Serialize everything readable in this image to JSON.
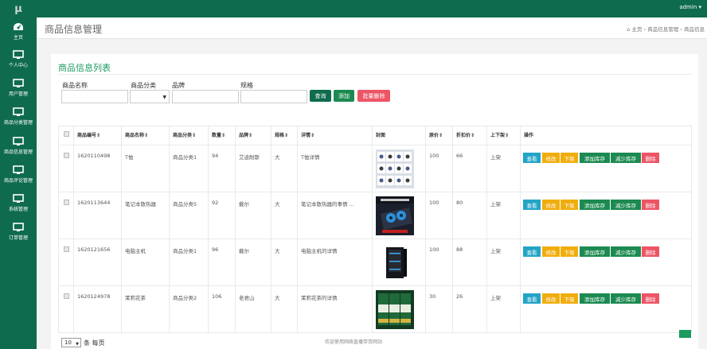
{
  "app": {
    "logo": "µ",
    "user": "admin ▾"
  },
  "sidebar": {
    "items": [
      {
        "label": "主页",
        "icon": "dashboard-icon"
      },
      {
        "label": "个人中心",
        "icon": "monitor-icon"
      },
      {
        "label": "用户管理",
        "icon": "monitor-icon"
      },
      {
        "label": "商品分类管理",
        "icon": "monitor-icon"
      },
      {
        "label": "商品信息管理",
        "icon": "monitor-icon"
      },
      {
        "label": "商品评论管理",
        "icon": "monitor-icon"
      },
      {
        "label": "系统管理",
        "icon": "monitor-icon"
      },
      {
        "label": "订单管理",
        "icon": "monitor-icon"
      }
    ]
  },
  "header": {
    "title": "商品信息管理",
    "breadcrumb": [
      "主页",
      "商品信息管理",
      "商品信息"
    ]
  },
  "panel": {
    "title": "商品信息列表"
  },
  "filters": {
    "name_label": "商品名称",
    "category_label": "商品分类",
    "brand_label": "品牌",
    "spec_label": "规格",
    "name_value": "",
    "brand_value": "",
    "spec_value": "",
    "category_value": ""
  },
  "toolbar": {
    "query": "查询",
    "add": "添加",
    "batch_delete": "批量删除"
  },
  "table": {
    "headers": [
      "商品编号⇕",
      "商品名称⇕",
      "商品分类⇕",
      "数量⇕",
      "品牌⇕",
      "规格⇕",
      "详情⇕",
      "封面",
      "原价⇕",
      "折扣价⇕",
      "上下架⇕",
      "操作"
    ],
    "rows": [
      {
        "id": "1620110498",
        "name": "T恤",
        "category": "商品分类1",
        "qty": "94",
        "brand": "艾迪耐斯",
        "spec": "大",
        "detail": "T恤详情",
        "price": "100",
        "discount": "66",
        "status": "上架"
      },
      {
        "id": "1620113644",
        "name": "笔记本散热器",
        "category": "商品分类5",
        "qty": "92",
        "brand": "戴尔",
        "spec": "大",
        "detail": "笔记本散热器的事情 ...",
        "price": "100",
        "discount": "80",
        "status": "上架"
      },
      {
        "id": "1620121656",
        "name": "电脑主机",
        "category": "商品分类1",
        "qty": "96",
        "brand": "戴尔",
        "spec": "大",
        "detail": "电脑主机的详情",
        "price": "100",
        "discount": "88",
        "status": "上架"
      },
      {
        "id": "1620124978",
        "name": "茉莉花茶",
        "category": "商品分类2",
        "qty": "106",
        "brand": "老君山",
        "spec": "大",
        "detail": "茉莉花茶的详情",
        "price": "30",
        "discount": "26",
        "status": "上架"
      }
    ],
    "actions": {
      "view": "查看",
      "edit": "修改",
      "delist": "下架",
      "add_stock": "添加库存",
      "reduce_stock": "减少库存",
      "delete": "删除"
    }
  },
  "pagination": {
    "per_page_value": "10",
    "per_page_label": "条 每页"
  },
  "footer": {
    "copyright": "欢迎使用网络直播带货网站"
  },
  "colors": {
    "primary": "#0f6b4e",
    "info": "#23a4c6",
    "warning": "#f0ad0e",
    "success": "#1c8a51",
    "danger": "#ed5565"
  }
}
